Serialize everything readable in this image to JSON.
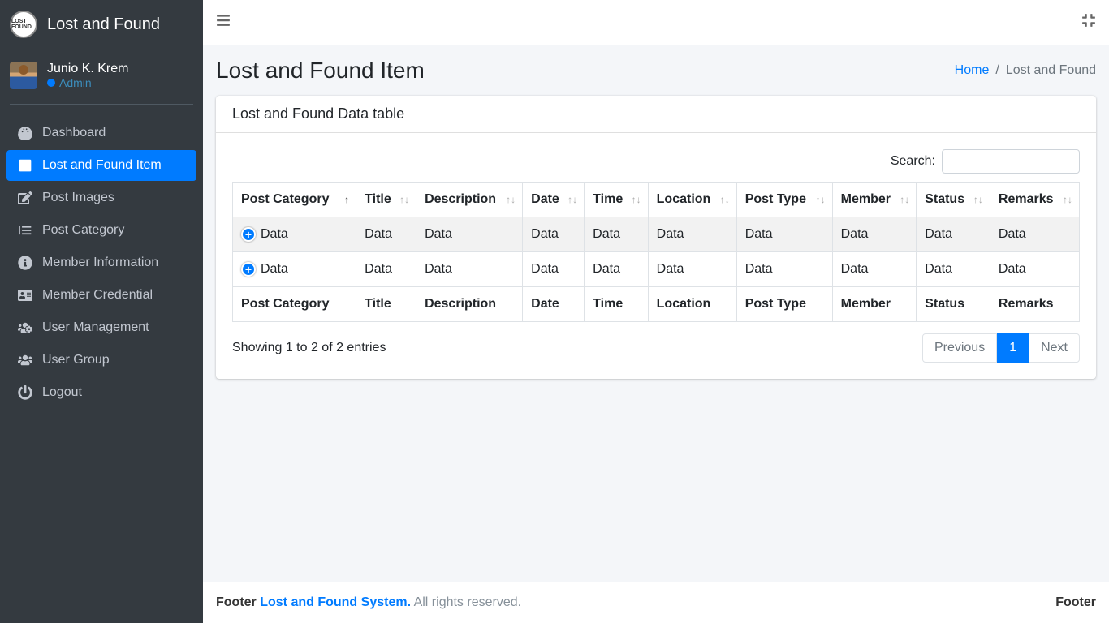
{
  "brand": {
    "text": "Lost and Found",
    "logoText": "LOST FOUND"
  },
  "user": {
    "name": "Junio K. Krem",
    "role": "Admin"
  },
  "sidebar": {
    "items": [
      {
        "label": "Dashboard"
      },
      {
        "label": "Lost and Found Item"
      },
      {
        "label": "Post Images"
      },
      {
        "label": "Post Category"
      },
      {
        "label": "Member Information"
      },
      {
        "label": "Member Credential"
      },
      {
        "label": "User Management"
      },
      {
        "label": "User Group"
      },
      {
        "label": "Logout"
      }
    ]
  },
  "page": {
    "title": "Lost and Found Item",
    "breadcrumb": {
      "home": "Home",
      "current": "Lost and Found"
    }
  },
  "card": {
    "title": "Lost and Found Data table"
  },
  "search": {
    "label": "Search:",
    "value": ""
  },
  "table": {
    "columns": [
      "Post Category",
      "Title",
      "Description",
      "Date",
      "Time",
      "Location",
      "Post Type",
      "Member",
      "Status",
      "Remarks"
    ],
    "rows": [
      [
        "Data",
        "Data",
        "Data",
        "Data",
        "Data",
        "Data",
        "Data",
        "Data",
        "Data",
        "Data"
      ],
      [
        "Data",
        "Data",
        "Data",
        "Data",
        "Data",
        "Data",
        "Data",
        "Data",
        "Data",
        "Data"
      ]
    ]
  },
  "info": "Showing 1 to 2 of 2 entries",
  "pagination": {
    "previous": "Previous",
    "page": "1",
    "next": "Next"
  },
  "footer": {
    "leftPrefix": "Footer ",
    "link": "Lost and Found System.",
    "leftSuffix": " All rights reserved.",
    "right": "Footer"
  }
}
